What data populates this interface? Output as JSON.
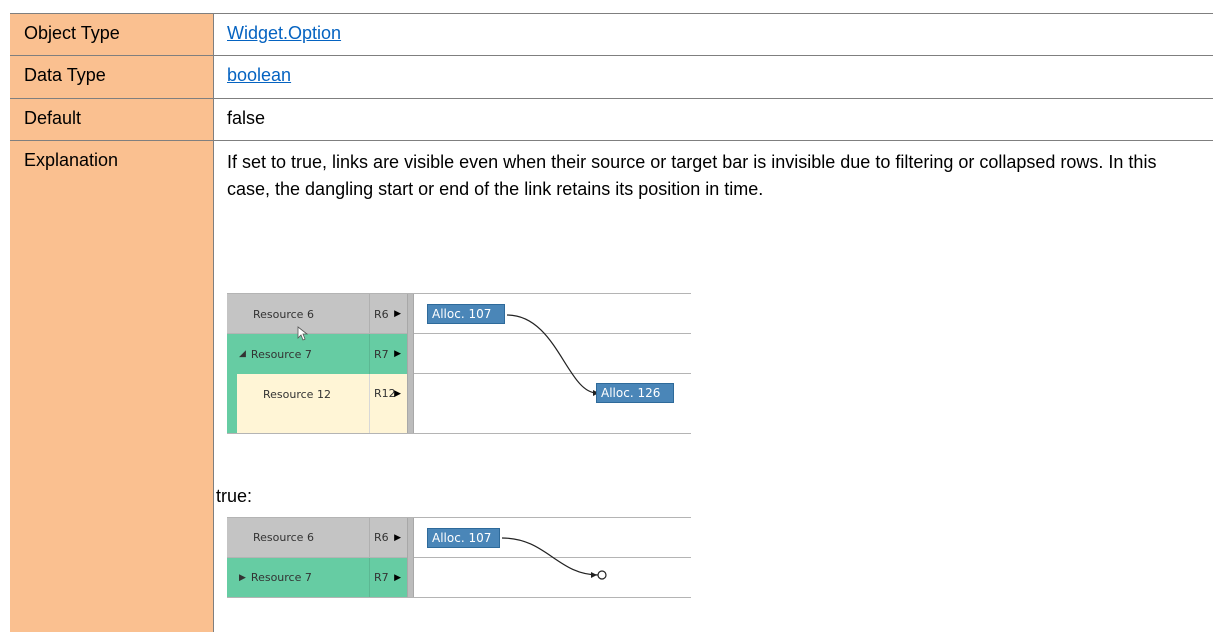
{
  "rows": {
    "object_type": {
      "label": "Object Type",
      "value": "Widget.Option"
    },
    "data_type": {
      "label": "Data Type",
      "value": "boolean"
    },
    "default": {
      "label": "Default",
      "value": "false"
    },
    "explanation": {
      "label": "Explanation",
      "text": "If set to true, links are visible even when their source or target bar is invisible due to filtering or collapsed rows. In this case, the dangling start or end of the link retains its position in time."
    }
  },
  "colors": {
    "label_bg": "#fac090",
    "link": "#0563c1",
    "bar": "#4a86b8",
    "green_row": "#66cca3",
    "grey_row": "#c4c4c4",
    "cream_row": "#fff5d6"
  },
  "example_false": {
    "rows": [
      {
        "name": "Resource 6",
        "code": "R6",
        "expander": ""
      },
      {
        "name": "Resource 7",
        "code": "R7",
        "expander": "◢"
      },
      {
        "name": "Resource 12",
        "code": "R12",
        "expander": ""
      }
    ],
    "bars": [
      "Alloc. 107",
      "Alloc. 126"
    ]
  },
  "example_true": {
    "label": "true:",
    "rows": [
      {
        "name": "Resource 6",
        "code": "R6",
        "expander": ""
      },
      {
        "name": "Resource 7",
        "code": "R7",
        "expander": "▶"
      }
    ],
    "bars": [
      "Alloc. 107"
    ]
  },
  "icons": {
    "row_arrow": "▶"
  }
}
